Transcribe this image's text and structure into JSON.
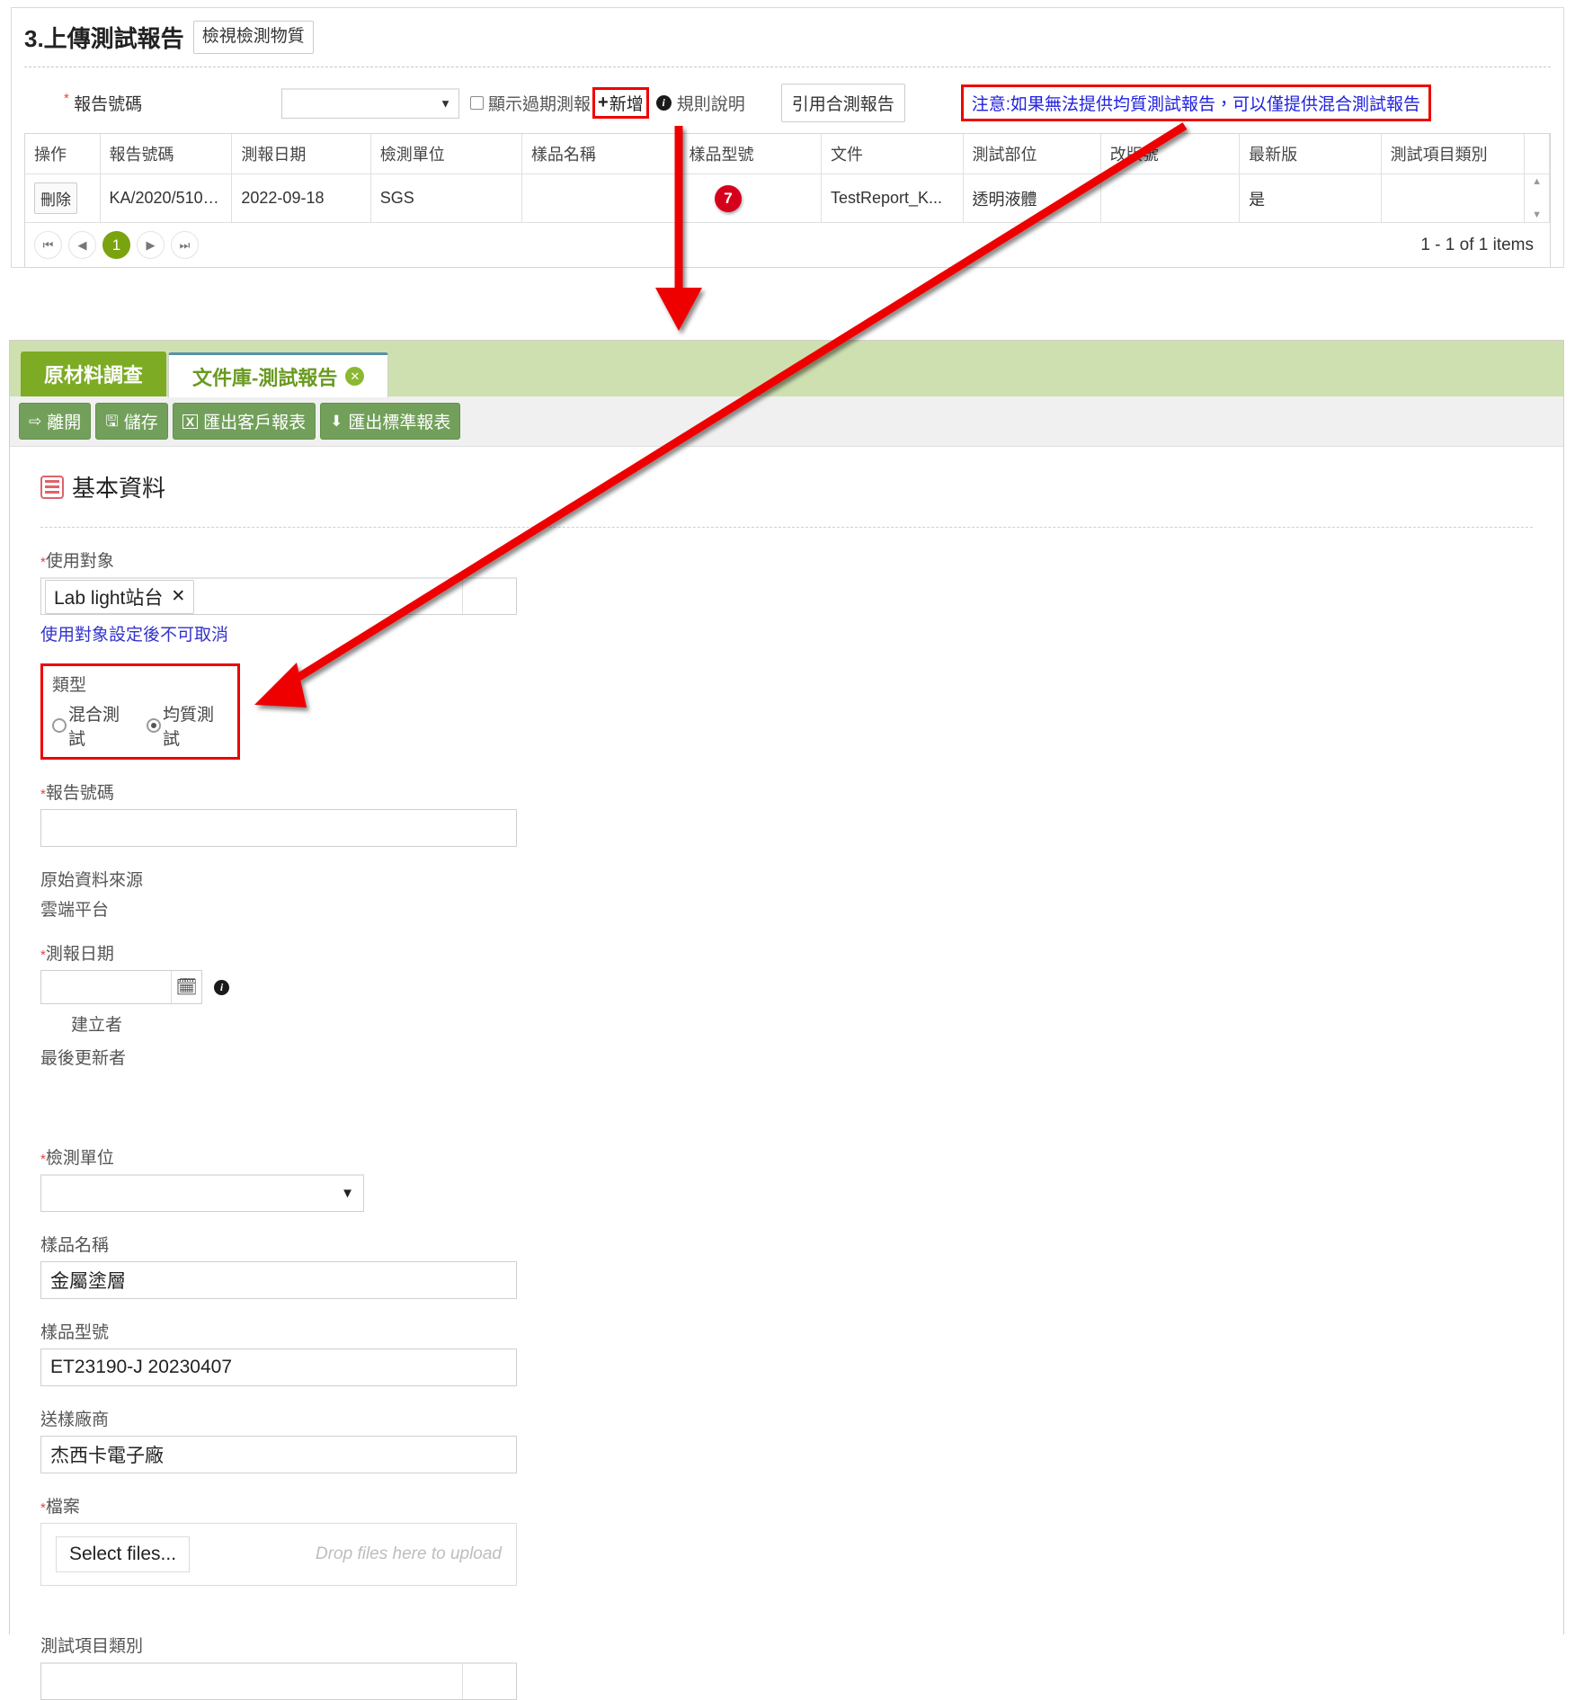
{
  "top_panel": {
    "section_title": "3.上傳測試報告",
    "view_substance_button": "檢視檢測物質",
    "report_no_label": "報告號碼",
    "report_no_value": "",
    "show_expired_checkbox": "顯示過期測報",
    "add_button": "新增",
    "rule_desc_label": "規則說明",
    "quote_button": "引用合測報告",
    "notice_text": "注意:如果無法提供均質測試報告，可以僅提供混合測試報告",
    "notice_color": "#2020e0",
    "notice_border_color": "#ee0000"
  },
  "grid": {
    "columns": [
      "操作",
      "報告號碼",
      "測報日期",
      "檢測單位",
      "樣品名稱",
      "樣品型號",
      "文件",
      "測試部位",
      "改版號",
      "最新版",
      "測試項目類別"
    ],
    "rows": [
      {
        "action": "刪除",
        "report_no": "KA/2020/5101...",
        "report_date": "2022-09-18",
        "lab": "SGS",
        "sample_name": "",
        "sample_model": "",
        "document": "TestReport_K...",
        "test_part": "透明液體",
        "revision": "",
        "latest": "是",
        "test_category": ""
      }
    ],
    "pager": {
      "first": "⏮",
      "prev": "◀",
      "current_page": "1",
      "next": "▶",
      "last": "⏭",
      "item_count": "1 - 1 of 1 items"
    }
  },
  "bottom_panel": {
    "tabs": [
      {
        "label": "原材料調查",
        "active": false,
        "closable": false
      },
      {
        "label": "文件庫-測試報告",
        "active": true,
        "closable": true
      }
    ],
    "toolbar": [
      {
        "label": "離開",
        "icon": "exit-icon",
        "glyph": "⇨"
      },
      {
        "label": "儲存",
        "icon": "save-icon",
        "glyph": "🖫"
      },
      {
        "label": "匯出客戶報表",
        "icon": "excel-icon",
        "glyph": "X"
      },
      {
        "label": "匯出標準報表",
        "icon": "download-icon",
        "glyph": "⬇"
      }
    ],
    "section": {
      "title": "基本資料",
      "icon": "list-icon"
    },
    "fields": {
      "target_label": "使用對象",
      "target_chip": "Lab light站台",
      "target_chip_remove": "✕",
      "target_hint": "使用對象設定後不可取消",
      "type_label": "類型",
      "type_options": [
        {
          "label": "混合測試",
          "selected": false
        },
        {
          "label": "均質測試",
          "selected": true
        }
      ],
      "report_no_label": "報告號碼",
      "report_no_value": "",
      "source_label": "原始資料來源",
      "source_value": "雲端平台",
      "report_date_label": "測報日期",
      "report_date_value": "",
      "creator_label": "建立者",
      "creator_value": "",
      "last_updater_label": "最後更新者",
      "last_updater_value": "",
      "lab_label": "檢測單位",
      "lab_value": "",
      "sample_name_label": "樣品名稱",
      "sample_name_value": "金屬塗層",
      "sample_model_label": "樣品型號",
      "sample_model_value": "ET23190-J 20230407",
      "supplier_label": "送樣廠商",
      "supplier_value": "杰西卡電子廠",
      "file_label": "檔案",
      "select_files_button": "Select files...",
      "drop_hint": "Drop files here to upload",
      "test_category_label": "測試項目類別",
      "test_category_value": ""
    }
  },
  "annotations": {
    "step_badge": "7",
    "badge_color": "#d6001c",
    "arrow_color": "#ee0000"
  }
}
